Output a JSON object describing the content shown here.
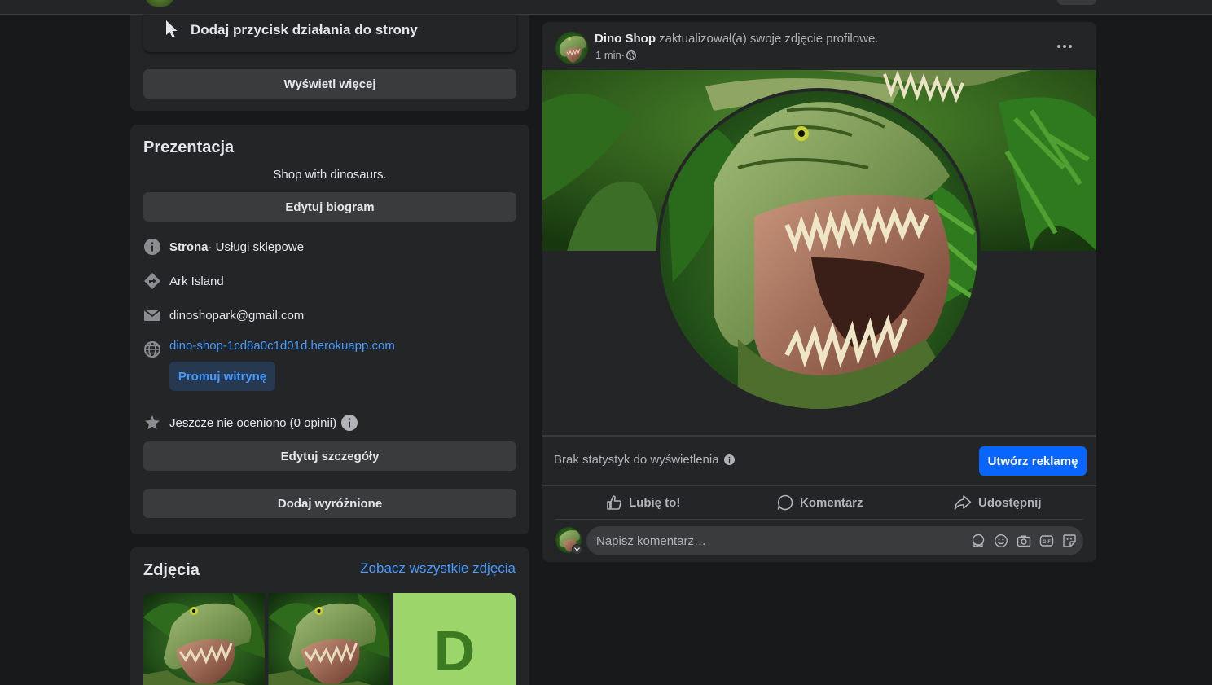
{
  "page_actions": {
    "add_action_button_label": "Dodaj przycisk działania do strony",
    "see_more_label": "Wyświetl więcej"
  },
  "intro": {
    "title": "Prezentacja",
    "bio": "Shop with dinosaurs.",
    "edit_bio_label": "Edytuj biogram",
    "category_bold": "Strona",
    "category_rest": " · Usługi sklepowe",
    "location": "Ark Island",
    "email": "dinoshopark@gmail.com",
    "website": "dino-shop-1cd8a0c1d01d.herokuapp.com",
    "promote_website_label": "Promuj witrynę",
    "rating": "Jeszcze nie oceniono (0 opinii)",
    "edit_details_label": "Edytuj szczegóły",
    "add_featured_label": "Dodaj wyróżnione"
  },
  "photos": {
    "title": "Zdjęcia",
    "see_all_label": "Zobacz wszystkie zdjęcia",
    "placeholder_letter": "D"
  },
  "post": {
    "author": "Dino Shop",
    "action_text": " zaktualizował(a) swoje zdjęcie profilowe.",
    "time": "1 min",
    "time_separator": " · ",
    "stats_text": "Brak statystyk do wyświetlenia",
    "create_ad_label": "Utwórz reklamę",
    "like_label": "Lubię to!",
    "comment_label": "Komentarz",
    "share_label": "Udostępnij",
    "comment_placeholder": "Napisz komentarz…"
  },
  "colors": {
    "background": "#18191a",
    "card": "#242526",
    "button_grey": "#3a3b3c",
    "accent_blue": "#0866ff",
    "link_blue": "#4599ff",
    "text_primary": "#e4e6eb",
    "text_secondary": "#b0b3b8",
    "photo_placeholder_bg": "#9cd66b",
    "photo_placeholder_fg": "#3c7a22"
  },
  "icons": {
    "cursor": "cursor-click-icon",
    "info": "info-circle-icon",
    "directions": "directions-icon",
    "mail": "mail-icon",
    "globe": "globe-icon",
    "star": "star-icon",
    "more": "more-horizontal-icon",
    "like": "thumbs-up-icon",
    "comment": "comment-bubble-icon",
    "share": "share-arrow-icon"
  }
}
